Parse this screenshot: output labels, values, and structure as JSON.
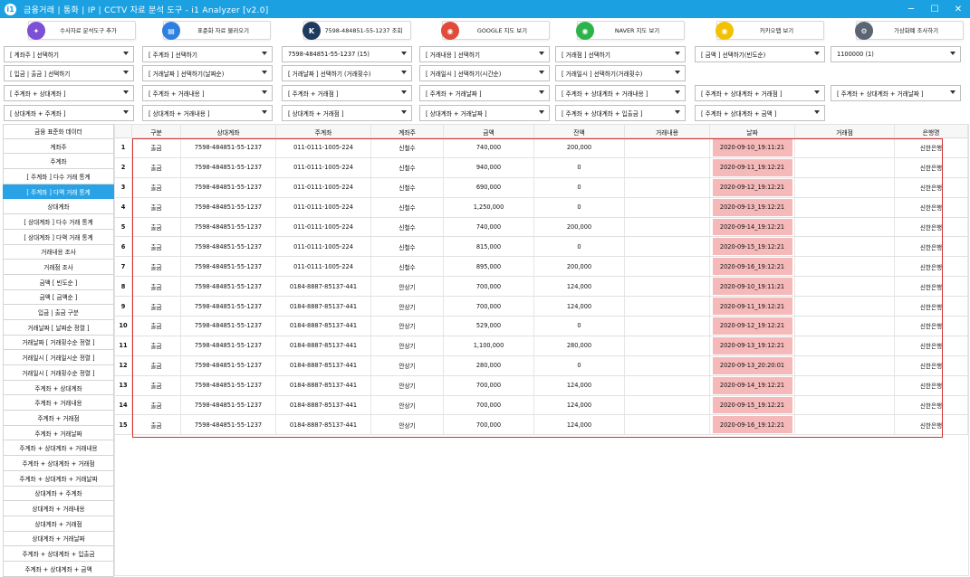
{
  "window": {
    "title": "금융거래 | 통화 | IP | CCTV 자료 분석 도구 - i1 Analyzer [v2.0]",
    "app_icon": "i1",
    "minimize": "─",
    "maximize": "☐",
    "close": "✕"
  },
  "toolbar": [
    {
      "label": "수사자료 분석도구 추가",
      "icon": "puzzle-icon",
      "color": "#7b4fd6",
      "glyph": "✦"
    },
    {
      "label": "표준화 자료 불러오기",
      "icon": "document-icon",
      "color": "#2f7fe0",
      "glyph": "▤"
    },
    {
      "label": "7598-484851-55-1237 조회",
      "icon": "kisa-logo-icon",
      "color": "#1e3a5f",
      "glyph": "K"
    },
    {
      "label": "GOOGLE 지도 보기",
      "icon": "google-maps-icon",
      "color": "#e04b3a",
      "glyph": "◉"
    },
    {
      "label": "NAVER 지도 보기",
      "icon": "naver-map-icon",
      "color": "#2cb34a",
      "glyph": "◉"
    },
    {
      "label": "카카오맵 보기",
      "icon": "kakao-map-icon",
      "color": "#f2c200",
      "glyph": "◉"
    },
    {
      "label": "가상화폐 조사하기",
      "icon": "coin-gear-icon",
      "color": "#5a6472",
      "glyph": "⚙"
    }
  ],
  "filters": [
    [
      "[ 계좌주 ] 선택하기",
      "[ 주계좌 ] 선택하기",
      "7598-484851-55-1237 (15)",
      "[ 거래내용 ] 선택하기",
      "[ 거래점 ] 선택하기",
      "[ 금액 ] 선택하기(빈도순)",
      "1100000 (1)"
    ],
    [
      "[ 입금 | 출금 ] 선택하기",
      "[ 거래날짜 ] 선택하기(날짜순)",
      "[ 거래날짜 ] 선택하기 (거래횟수)",
      "[ 거래일시 ] 선택하기(시간순)",
      "[ 거래일시 ] 선택하기(거래횟수)"
    ],
    [
      "[ 주계좌 + 상대계좌 ]",
      "[ 주계좌 + 거래내용 ]",
      "[ 주계좌 + 거래점 ]",
      "[ 주계좌 + 거래날짜 ]",
      "[ 주계좌 + 상대계좌 + 거래내용 ]",
      "[ 주계좌 + 상대계좌 + 거래점 ]",
      "[ 주계좌 + 상대계좌 + 거래날짜 ]"
    ],
    [
      "[ 상대계좌 + 주계좌 ]",
      "[ 상대계좌 + 거래내용 ]",
      "[ 상대계좌 + 거래점 ]",
      "[ 상대계좌 + 거래날짜 ]",
      "[ 주계좌 + 상대계좌 + 입출금 ]",
      "[ 주계좌 + 상대계좌 + 금액 ]"
    ]
  ],
  "sidebar": {
    "active_index": 4,
    "items": [
      "금융 표준화 데이터",
      "계좌주",
      "주계좌",
      "[ 주계좌 ] 다수 거래 통계",
      "[ 주계좌 ] 다액 거래 통계",
      "상대계좌",
      "[ 상대계좌 ] 다수 거래 통계",
      "[ 상대계좌 ] 다액 거래 통계",
      "거래내용 조사",
      "거래점 조사",
      "금액 [ 빈도순 ]",
      "금액 [ 금액순 ]",
      "입금 | 출금 구분",
      "거래날짜 [ 날짜순 정렬 ]",
      "거래날짜 [ 거래횟수순 정렬 ]",
      "거래일시 [ 거래일시순 정렬 ]",
      "거래일시 [ 거래횟수순 정렬 ]",
      "주계좌 + 상대계좌",
      "주계좌 + 거래내용",
      "주계좌 + 거래점",
      "주계좌 + 거래날짜",
      "주계좌 + 상대계좌 + 거래내용",
      "주계좌 + 상대계좌 + 거래점",
      "주계좌 + 상대계좌 + 거래날짜",
      "상대계좌 + 주계좌",
      "상대계좌 + 거래내용",
      "상대계좌 + 거래점",
      "상대계좌 + 거래날짜",
      "주계좌 + 상대계좌 + 입출금",
      "주계좌 + 상대계좌 + 금액"
    ]
  },
  "grid": {
    "columns": [
      "",
      "구분",
      "상대계좌",
      "주계좌",
      "계좌주",
      "금액",
      "잔액",
      "거래내용",
      "날짜",
      "거래점",
      "은행명"
    ],
    "highlight_color": "#f6b9b9",
    "rows": [
      [
        "1",
        "출금",
        "7598-484851-55-1237",
        "011-0111-1005-224",
        "신철수",
        "740,000",
        "200,000",
        "",
        "2020-09-10_19:11:21",
        "",
        "신한은행"
      ],
      [
        "2",
        "출금",
        "7598-484851-55-1237",
        "011-0111-1005-224",
        "신철수",
        "940,000",
        "0",
        "",
        "2020-09-11_19:12:21",
        "",
        "신한은행"
      ],
      [
        "3",
        "출금",
        "7598-484851-55-1237",
        "011-0111-1005-224",
        "신철수",
        "690,000",
        "0",
        "",
        "2020-09-12_19:12:21",
        "",
        "신한은행"
      ],
      [
        "4",
        "출금",
        "7598-484851-55-1237",
        "011-0111-1005-224",
        "신철수",
        "1,250,000",
        "0",
        "",
        "2020-09-13_19:12:21",
        "",
        "신한은행"
      ],
      [
        "5",
        "출금",
        "7598-484851-55-1237",
        "011-0111-1005-224",
        "신철수",
        "740,000",
        "200,000",
        "",
        "2020-09-14_19:12:21",
        "",
        "신한은행"
      ],
      [
        "6",
        "출금",
        "7598-484851-55-1237",
        "011-0111-1005-224",
        "신철수",
        "815,000",
        "0",
        "",
        "2020-09-15_19:12:21",
        "",
        "신한은행"
      ],
      [
        "7",
        "출금",
        "7598-484851-55-1237",
        "011-0111-1005-224",
        "신철수",
        "895,000",
        "200,000",
        "",
        "2020-09-16_19:12:21",
        "",
        "신한은행"
      ],
      [
        "8",
        "출금",
        "7598-484851-55-1237",
        "0184-8887-85137-441",
        "안상기",
        "700,000",
        "124,000",
        "",
        "2020-09-10_19:11:21",
        "",
        "신한은행"
      ],
      [
        "9",
        "출금",
        "7598-484851-55-1237",
        "0184-8887-85137-441",
        "안상기",
        "700,000",
        "124,000",
        "",
        "2020-09-11_19:12:21",
        "",
        "신한은행"
      ],
      [
        "10",
        "출금",
        "7598-484851-55-1237",
        "0184-8887-85137-441",
        "안상기",
        "529,000",
        "0",
        "",
        "2020-09-12_19:12:21",
        "",
        "신한은행"
      ],
      [
        "11",
        "출금",
        "7598-484851-55-1237",
        "0184-8887-85137-441",
        "안상기",
        "1,100,000",
        "280,000",
        "",
        "2020-09-13_19:12:21",
        "",
        "신한은행"
      ],
      [
        "12",
        "출금",
        "7598-484851-55-1237",
        "0184-8887-85137-441",
        "안상기",
        "280,000",
        "0",
        "",
        "2020-09-13_20:20:01",
        "",
        "신한은행"
      ],
      [
        "13",
        "출금",
        "7598-484851-55-1237",
        "0184-8887-85137-441",
        "안상기",
        "700,000",
        "124,000",
        "",
        "2020-09-14_19:12:21",
        "",
        "신한은행"
      ],
      [
        "14",
        "출금",
        "7598-484851-55-1237",
        "0184-8887-85137-441",
        "안상기",
        "700,000",
        "124,000",
        "",
        "2020-09-15_19:12:21",
        "",
        "신한은행"
      ],
      [
        "15",
        "출금",
        "7598-484851-55-1237",
        "0184-8887-85137-441",
        "안상기",
        "700,000",
        "124,000",
        "",
        "2020-09-16_19:12:21",
        "",
        "신한은행"
      ]
    ]
  }
}
